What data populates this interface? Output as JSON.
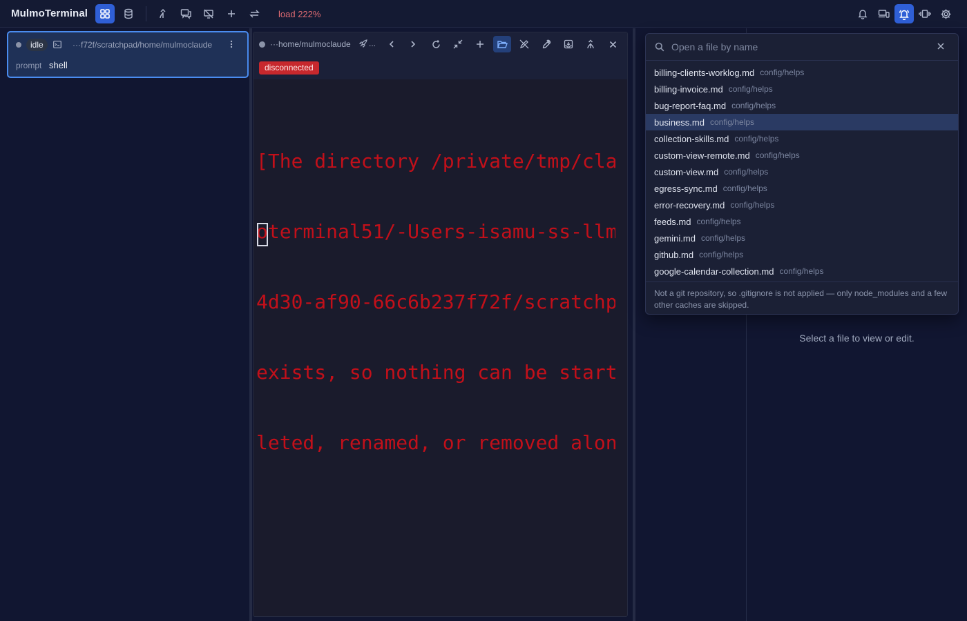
{
  "app": {
    "title": "MulmoTerminal",
    "load": "load 222%"
  },
  "toolbar": {
    "buttons": [
      "grid-layout",
      "database",
      "merge",
      "chat",
      "wifi-off",
      "add",
      "swap"
    ],
    "right_buttons": [
      "bell",
      "devices",
      "bell-ringing",
      "vibrate",
      "settings"
    ]
  },
  "session": {
    "status": "idle",
    "path": "···f72f/scratchpad/home/mulmoclaude",
    "prompt_label": "prompt",
    "prompt_value": "shell"
  },
  "terminal": {
    "path": "···home/mulmoclaude",
    "rocket_label": "...",
    "status_badge": "disconnected",
    "lines": [
      "[The directory /private/tmp/cla",
      "oterminal51/-Users-isamu-ss-llm",
      "4d30-af90-66c6b237f72f/scratchp",
      "exists, so nothing can be start",
      "leted, renamed, or removed alon"
    ]
  },
  "file_palette": {
    "placeholder": "Open a file by name",
    "files": [
      {
        "name": "billing-clients-worklog.md",
        "dir": "config/helps"
      },
      {
        "name": "billing-invoice.md",
        "dir": "config/helps"
      },
      {
        "name": "bug-report-faq.md",
        "dir": "config/helps"
      },
      {
        "name": "business.md",
        "dir": "config/helps",
        "selected": true
      },
      {
        "name": "collection-skills.md",
        "dir": "config/helps"
      },
      {
        "name": "custom-view-remote.md",
        "dir": "config/helps"
      },
      {
        "name": "custom-view.md",
        "dir": "config/helps"
      },
      {
        "name": "egress-sync.md",
        "dir": "config/helps"
      },
      {
        "name": "error-recovery.md",
        "dir": "config/helps"
      },
      {
        "name": "feeds.md",
        "dir": "config/helps"
      },
      {
        "name": "gemini.md",
        "dir": "config/helps"
      },
      {
        "name": "github.md",
        "dir": "config/helps"
      },
      {
        "name": "google-calendar-collection.md",
        "dir": "config/helps"
      }
    ],
    "footer": "Not a git repository, so .gitignore is not applied — only node_modules and a few other caches are skipped."
  },
  "viewer": {
    "empty_text": "Select a file to view or edit."
  },
  "colors": {
    "accent": "#2f5fd6",
    "selection_border": "#4a8cf0",
    "error": "#c2101a",
    "badge_red": "#c7282d"
  }
}
